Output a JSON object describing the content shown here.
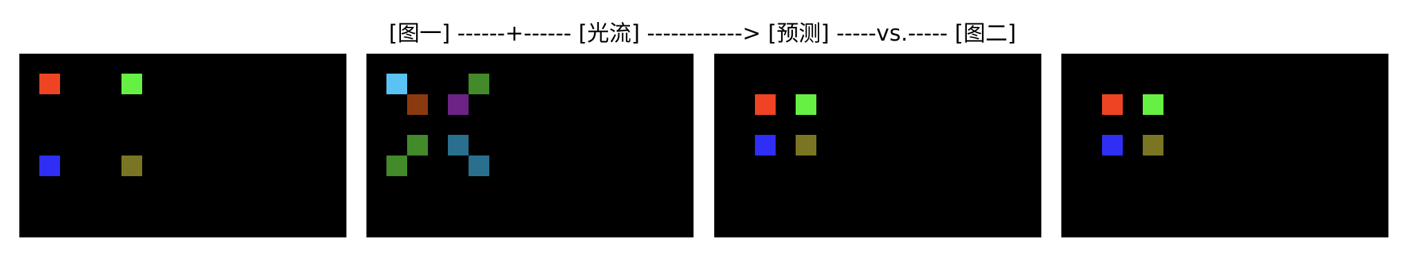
{
  "caption": "[图一] ------+------ [光流] ------------> [预测] -----vs.----- [图二]",
  "panels": [
    {
      "name": "image-one-panel",
      "cells": [
        {
          "name": "red-cell",
          "col": 1,
          "row": 1,
          "color": "#ef4423"
        },
        {
          "name": "green-cell",
          "col": 5,
          "row": 1,
          "color": "#66f044"
        },
        {
          "name": "blue-cell",
          "col": 1,
          "row": 5,
          "color": "#2e2ef5"
        },
        {
          "name": "olive-cell",
          "col": 5,
          "row": 5,
          "color": "#7a7522"
        }
      ]
    },
    {
      "name": "optical-flow-panel",
      "cells": [
        {
          "name": "light-blue-cell",
          "col": 1,
          "row": 1,
          "color": "#5bc3f4"
        },
        {
          "name": "brown-cell",
          "col": 2,
          "row": 2,
          "color": "#8b3a10"
        },
        {
          "name": "green-cell",
          "col": 5,
          "row": 1,
          "color": "#428a2a"
        },
        {
          "name": "purple-cell",
          "col": 4,
          "row": 2,
          "color": "#6d2386"
        },
        {
          "name": "green-cell",
          "col": 2,
          "row": 4,
          "color": "#428a2a"
        },
        {
          "name": "green-cell",
          "col": 1,
          "row": 5,
          "color": "#428a2a"
        },
        {
          "name": "teal-cell",
          "col": 4,
          "row": 4,
          "color": "#2b6f8e"
        },
        {
          "name": "teal-cell",
          "col": 5,
          "row": 5,
          "color": "#2b6f8e"
        }
      ]
    },
    {
      "name": "prediction-panel",
      "cells": [
        {
          "name": "red-cell",
          "col": 2,
          "row": 2,
          "color": "#ef4423"
        },
        {
          "name": "green-cell",
          "col": 4,
          "row": 2,
          "color": "#66f044"
        },
        {
          "name": "blue-cell",
          "col": 2,
          "row": 4,
          "color": "#2e2ef5"
        },
        {
          "name": "olive-cell",
          "col": 4,
          "row": 4,
          "color": "#7a7522"
        }
      ]
    },
    {
      "name": "image-two-panel",
      "cells": [
        {
          "name": "red-cell",
          "col": 2,
          "row": 2,
          "color": "#ef4423"
        },
        {
          "name": "green-cell",
          "col": 4,
          "row": 2,
          "color": "#66f044"
        },
        {
          "name": "blue-cell",
          "col": 2,
          "row": 4,
          "color": "#2e2ef5"
        },
        {
          "name": "olive-cell",
          "col": 4,
          "row": 4,
          "color": "#7a7522"
        }
      ]
    }
  ]
}
